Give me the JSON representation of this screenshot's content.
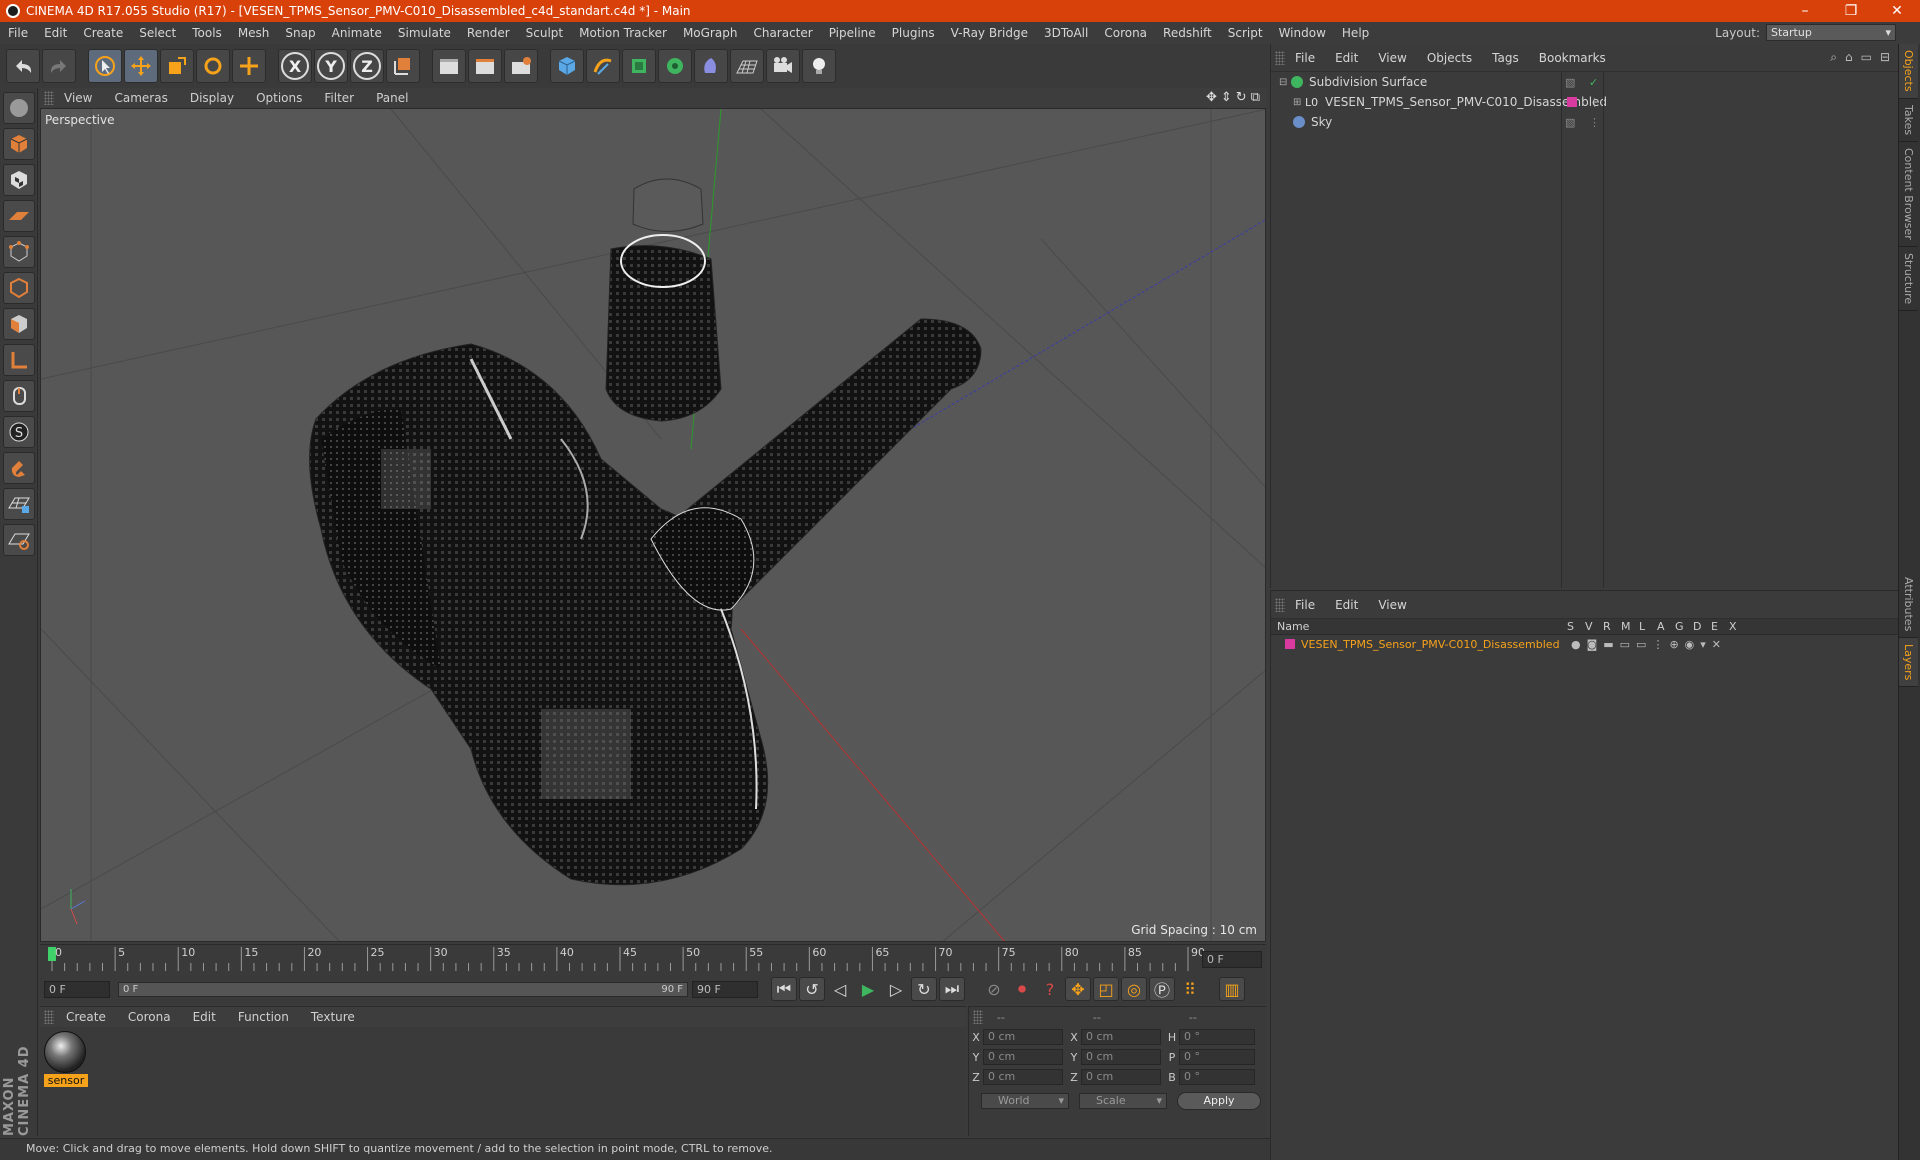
{
  "window": {
    "title": "CINEMA 4D R17.055 Studio (R17) - [VESEN_TPMS_Sensor_PMV-C010_Disassembled_c4d_standart.c4d *] - Main",
    "controls": [
      "–",
      "❐",
      "✕"
    ]
  },
  "menubar": {
    "items": [
      "File",
      "Edit",
      "Create",
      "Select",
      "Tools",
      "Mesh",
      "Snap",
      "Animate",
      "Simulate",
      "Render",
      "Sculpt",
      "Motion Tracker",
      "MoGraph",
      "Character",
      "Pipeline",
      "Plugins",
      "V-Ray Bridge",
      "3DToAll",
      "Corona",
      "Redshift",
      "Script",
      "Window",
      "Help"
    ],
    "layout_label": "Layout:",
    "layout_value": "Startup"
  },
  "toolbar": {
    "axis_x": "X",
    "axis_y": "Y",
    "axis_z": "Z"
  },
  "viewport": {
    "menu": [
      "View",
      "Cameras",
      "Display",
      "Options",
      "Filter",
      "Panel"
    ],
    "label": "Perspective",
    "grid_spacing": "Grid Spacing : 10 cm"
  },
  "timeline": {
    "ticks": [
      "0",
      "5",
      "10",
      "15",
      "20",
      "25",
      "30",
      "35",
      "40",
      "45",
      "50",
      "55",
      "60",
      "65",
      "70",
      "75",
      "80",
      "85",
      "90"
    ],
    "current_frame": "0 F",
    "start": "0 F",
    "range_start": "0 F",
    "range_end": "90 F",
    "end": "90 F"
  },
  "material": {
    "menu": [
      "Create",
      "Corona",
      "Edit",
      "Function",
      "Texture"
    ],
    "name": "sensor"
  },
  "coordinates": {
    "headers": [
      "--",
      "--",
      "--"
    ],
    "rows": [
      {
        "pos_label": "X",
        "pos": "0 cm",
        "size_label": "X",
        "size": "0 cm",
        "rot_label": "H",
        "rot": "0 °"
      },
      {
        "pos_label": "Y",
        "pos": "0 cm",
        "size_label": "Y",
        "size": "0 cm",
        "rot_label": "P",
        "rot": "0 °"
      },
      {
        "pos_label": "Z",
        "pos": "0 cm",
        "size_label": "Z",
        "size": "0 cm",
        "rot_label": "B",
        "rot": "0 °"
      }
    ],
    "world": "World",
    "scale": "Scale",
    "apply": "Apply"
  },
  "status": {
    "text": "Move: Click and drag to move elements. Hold down SHIFT to quantize movement / add to the selection in point mode, CTRL to remove."
  },
  "objects_panel": {
    "menu": [
      "File",
      "Edit",
      "View",
      "Objects",
      "Tags",
      "Bookmarks"
    ],
    "items": [
      {
        "name": "Subdivision Surface",
        "color": "#3fb55f"
      },
      {
        "name": "VESEN_TPMS_Sensor_PMV-C010_Disassembled",
        "color": "#cfcfcf"
      },
      {
        "name": "Sky",
        "color": "#6a8ec8"
      }
    ]
  },
  "layers_panel": {
    "menu": [
      "File",
      "Edit",
      "View"
    ],
    "headers": [
      "Name",
      "S",
      "V",
      "R",
      "M",
      "L",
      "A",
      "G",
      "D",
      "E",
      "X"
    ],
    "layer_name": "VESEN_TPMS_Sensor_PMV-C010_Disassembled",
    "layer_color": "#d83aa0"
  },
  "side_tabs": [
    "Objects",
    "Takes",
    "Content Browser",
    "Structure",
    "Attributes",
    "Layers"
  ],
  "colors": {
    "title_bar": "#d9410b",
    "accent": "#f6a21a"
  }
}
